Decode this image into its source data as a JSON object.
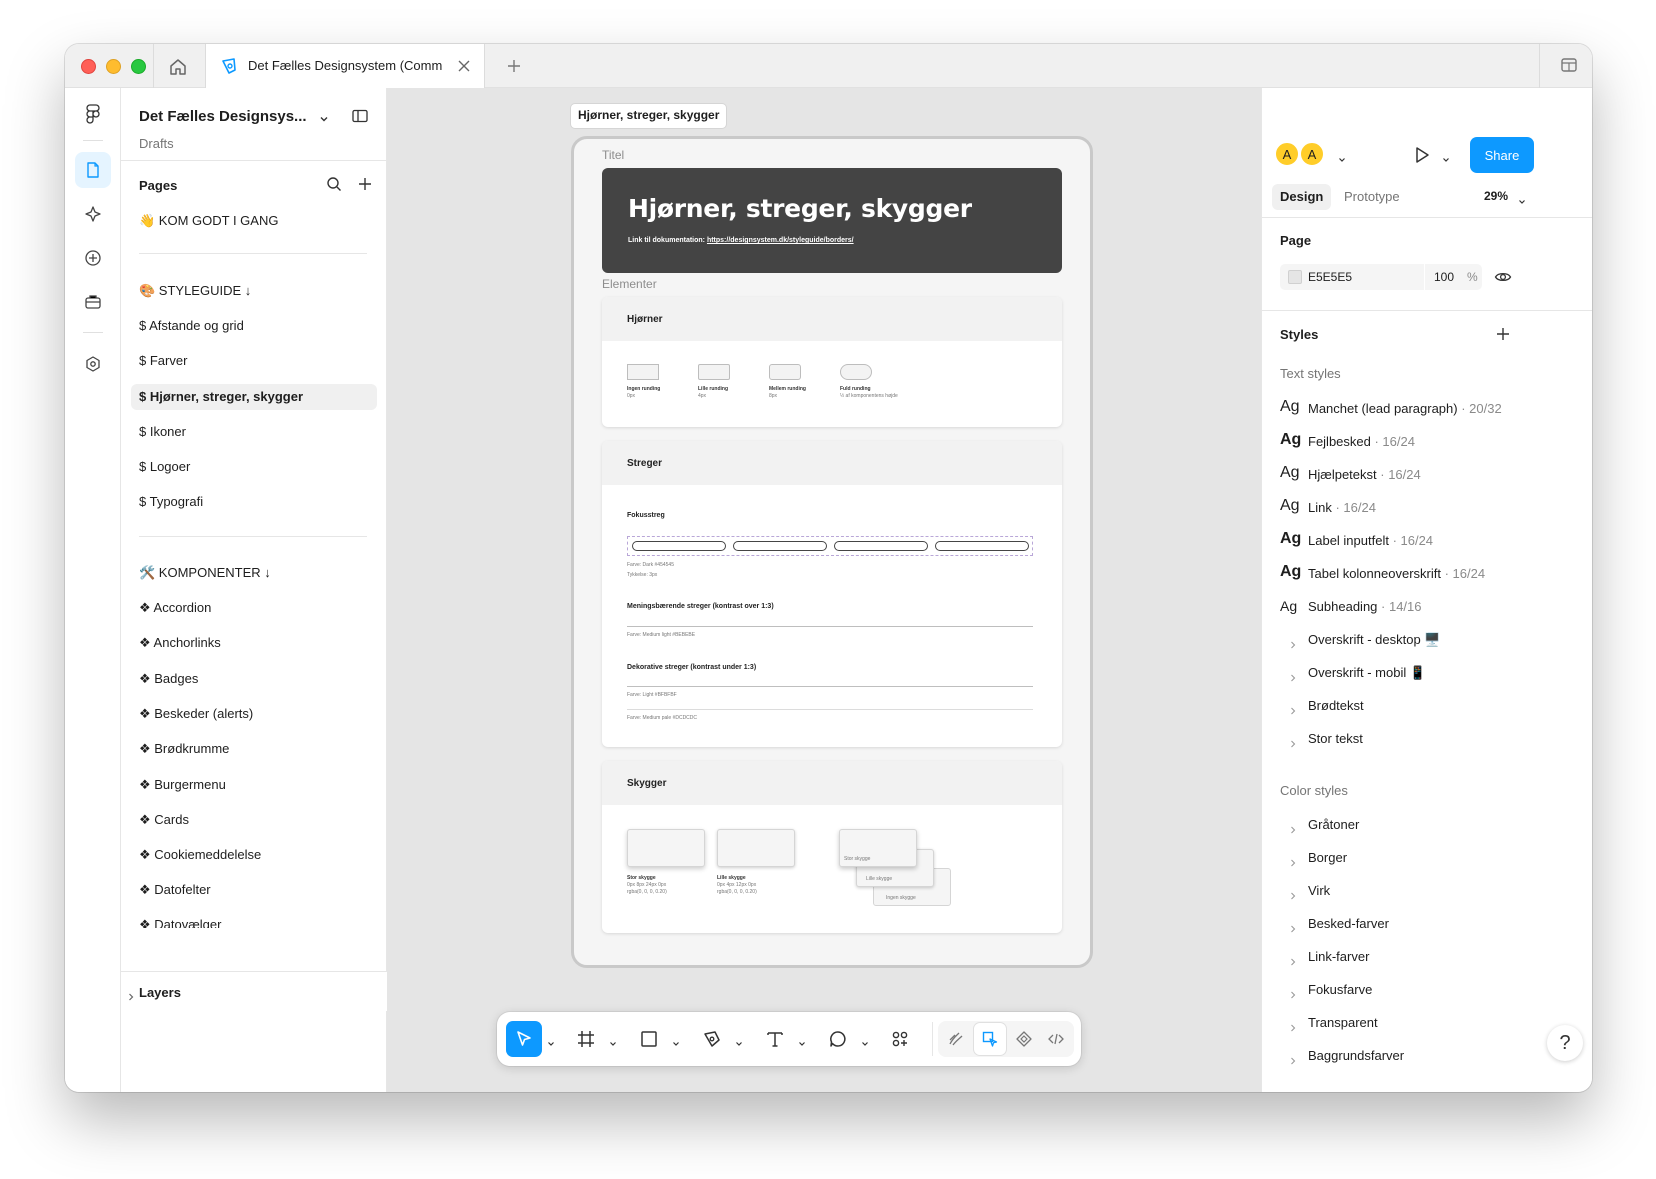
{
  "browser": {
    "tab_title": "Det Fælles Designsystem (Comm"
  },
  "file": {
    "name": "Det Fælles Designsys...",
    "location": "Drafts"
  },
  "pages": {
    "title": "Pages",
    "items": [
      {
        "label": "👋 KOM GODT I GANG"
      },
      {
        "label": "🎨 STYLEGUIDE ↓"
      },
      {
        "label": "$ Afstande og grid"
      },
      {
        "label": "$ Farver"
      },
      {
        "label": "$ Hjørner, streger, skygger",
        "selected": true
      },
      {
        "label": "$ Ikoner"
      },
      {
        "label": "$ Logoer"
      },
      {
        "label": "$ Typografi"
      },
      {
        "label": "🛠️ KOMPONENTER ↓"
      },
      {
        "label": "❖ Accordion"
      },
      {
        "label": "❖ Anchorlinks"
      },
      {
        "label": "❖ Badges"
      },
      {
        "label": "❖ Beskeder (alerts)"
      },
      {
        "label": "❖ Brødkrumme"
      },
      {
        "label": "❖ Burgermenu"
      },
      {
        "label": "❖ Cards"
      },
      {
        "label": "❖ Cookiemeddelelse"
      },
      {
        "label": "❖ Datofelter"
      },
      {
        "label": "❖ Datovælger"
      }
    ]
  },
  "layers": {
    "title": "Layers"
  },
  "canvas": {
    "frame_label": "Hjørner, streger, skygger",
    "section_title": "Titel",
    "section_elements": "Elementer",
    "hero_title": "Hjørner, streger, skygger",
    "hero_link_prefix": "Link til dokumentation: ",
    "hero_link_url": "https://designsystem.dk/styleguide/borders/",
    "corners": {
      "title": "Hjørner",
      "items": [
        {
          "name": "Ingen runding",
          "value": "0px"
        },
        {
          "name": "Lille runding",
          "value": "4px"
        },
        {
          "name": "Mellem runding",
          "value": "8px"
        },
        {
          "name": "Fuld runding",
          "value": "½ af komponentens højde"
        }
      ]
    },
    "strokes": {
      "title": "Streger",
      "focus_title": "Fokusstreg",
      "focus_color": "Farve: Dark #454545",
      "focus_thickness": "Tykkelse: 3px",
      "meaning_title": "Meningsbærende streger (kontrast over 1:3)",
      "meaning_color": "Farve: Medium light #BEBEBE",
      "deco_title": "Dekorative streger (kontrast under 1:3)",
      "deco_color_1": "Farve: Light #BFBFBF",
      "deco_color_2": "Farve: Medium pale #DCDCDC"
    },
    "shadows": {
      "title": "Skygger",
      "big_name": "Stor skygge",
      "big_spec": "0px 8px 24px 0px",
      "big_rgba": "rgba(0, 0, 0, 0.20)",
      "small_name": "Lille skygge",
      "small_spec": "0px 4px 12px 0px",
      "small_rgba": "rgba(0, 0, 0, 0.20)",
      "stack_1": "Stor skygge",
      "stack_2": "Lille skygge",
      "stack_3": "Ingen skygge"
    }
  },
  "toolbar": {
    "tools": [
      "move-tool",
      "frame-tool",
      "rectangle-tool",
      "pen-tool",
      "text-tool",
      "comment-tool",
      "actions-tool"
    ],
    "modes": [
      "draw-mode",
      "design-mode",
      "component-mode",
      "dev-mode"
    ]
  },
  "right": {
    "avatars": [
      "A",
      "A"
    ],
    "share": "Share",
    "tab_design": "Design",
    "tab_prototype": "Prototype",
    "zoom": "29%",
    "page_title": "Page",
    "page_color_hex": "E5E5E5",
    "page_opacity": "100",
    "page_opacity_unit": "%",
    "styles_title": "Styles",
    "text_styles_title": "Text styles",
    "text_styles": [
      {
        "ag": "Ag",
        "name": "Manchet (lead paragraph)",
        "meta": " · 20/32",
        "weight": "normal"
      },
      {
        "ag": "Ag",
        "name": "Fejlbesked",
        "meta": " · 16/24",
        "weight": "bold"
      },
      {
        "ag": "Ag",
        "name": "Hjælpetekst",
        "meta": " · 16/24",
        "weight": "normal"
      },
      {
        "ag": "Ag",
        "name": "Link",
        "meta": " · 16/24",
        "weight": "normal"
      },
      {
        "ag": "Ag",
        "name": "Label inputfelt",
        "meta": " · 16/24",
        "weight": "bold"
      },
      {
        "ag": "Ag",
        "name": "Tabel kolonneoverskrift",
        "meta": " · 16/24",
        "weight": "bold"
      },
      {
        "ag": "Ag",
        "name": "Subheading",
        "meta": " · 14/16",
        "weight": "normal"
      }
    ],
    "text_style_groups": [
      "Overskrift - desktop 🖥️",
      "Overskrift - mobil 📱",
      "Brødtekst",
      "Stor tekst"
    ],
    "color_styles_title": "Color styles",
    "color_style_groups": [
      "Gråtoner",
      "Borger",
      "Virk",
      "Besked-farver",
      "Link-farver",
      "Fokusfarve",
      "Transparent",
      "Baggrundsfarver"
    ],
    "help": "?"
  },
  "colors": {
    "accent": "#0d99ff",
    "canvas_bg": "#e5e5e5",
    "hero_bg": "#444444",
    "avatar": "#ffcd29"
  }
}
